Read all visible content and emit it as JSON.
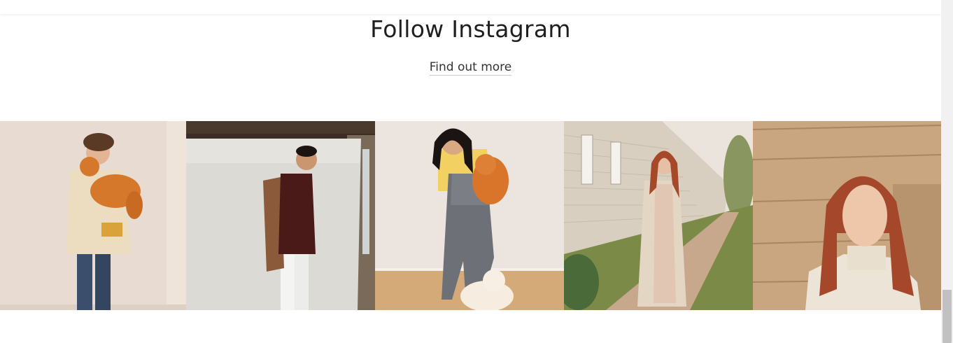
{
  "section": {
    "title": "Follow Instagram",
    "link_label": "Find out more"
  },
  "gallery": {
    "posts": [
      {
        "subject": "boy-with-cat-photo"
      },
      {
        "subject": "man-in-burgundy-sweater-photo"
      },
      {
        "subject": "girl-with-cats-photo"
      },
      {
        "subject": "woman-in-cardigan-outdoors-photo"
      },
      {
        "subject": "woman-in-turtleneck-portrait-photo"
      }
    ]
  },
  "colors": {
    "text": "#1f1f1f",
    "link": "#333333",
    "link_underline": "#c9c9c9",
    "scrollbar_track": "#f1f1f1",
    "scrollbar_thumb": "#c1c1c1"
  }
}
